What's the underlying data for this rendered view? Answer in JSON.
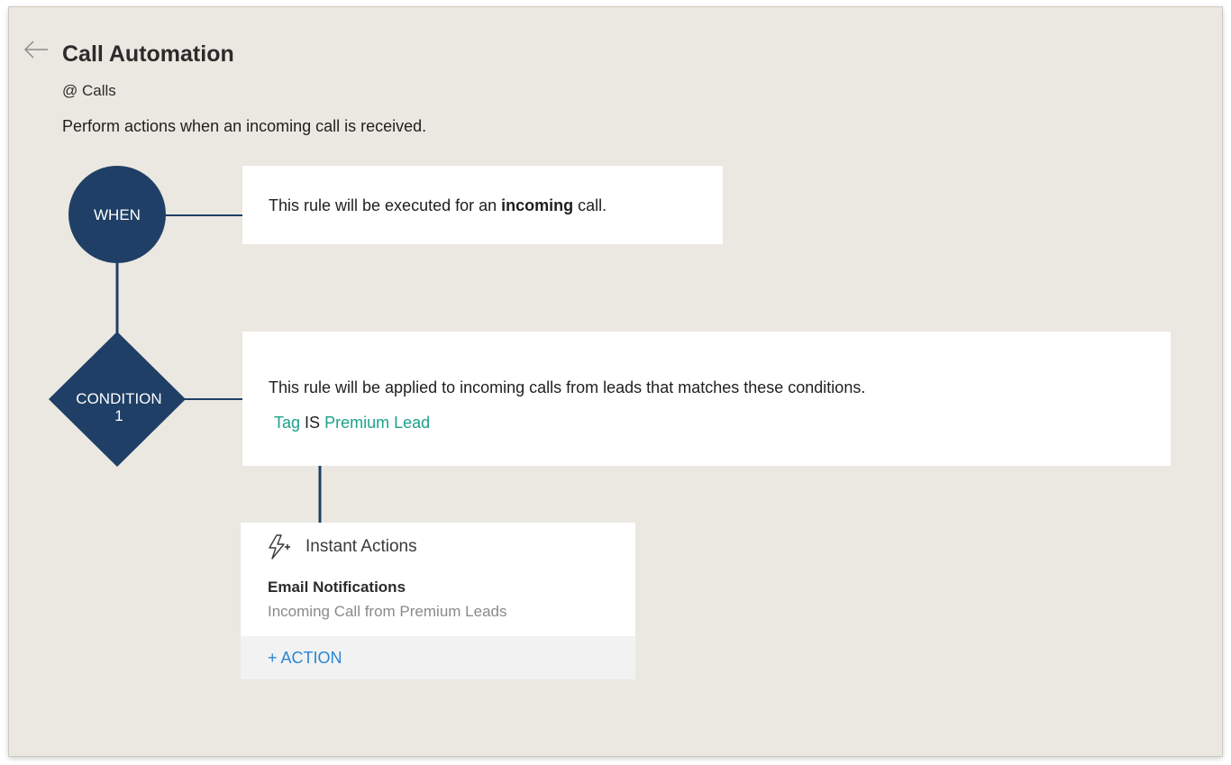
{
  "header": {
    "back_icon": "left-arrow-icon",
    "title": "Call Automation",
    "module": "@ Calls",
    "description": "Perform actions when an incoming call is received."
  },
  "flow": {
    "when_node": {
      "label": "WHEN",
      "text_before": "This rule will be executed for an ",
      "text_bold": "incoming",
      "text_after": " call."
    },
    "condition_node": {
      "label_line1": "CONDITION",
      "label_line2": "1",
      "text": "This rule will be applied to incoming calls from leads that matches these conditions.",
      "criteria": {
        "field": "Tag",
        "operator": "IS",
        "value": "Premium Lead"
      }
    },
    "actions": {
      "icon": "lightning-plus-icon",
      "title": "Instant Actions",
      "items": [
        {
          "name": "Email Notifications",
          "description": "Incoming Call from Premium Leads"
        }
      ],
      "add_action_label": "+ ACTION"
    }
  },
  "colors": {
    "background": "#ebe8e1",
    "node": "#1f3f66",
    "teal": "#1da18c",
    "link_blue": "#2a86d4"
  }
}
